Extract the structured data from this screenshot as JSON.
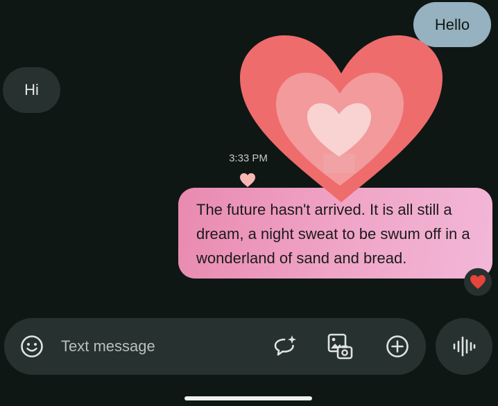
{
  "conversation": {
    "messages": [
      {
        "direction": "outgoing",
        "text": "Hello"
      },
      {
        "direction": "incoming",
        "text": "Hi"
      },
      {
        "direction": "outgoing",
        "text": "The future hasn't arrived. It is all still a dream, a night sweat to be swum off in a wonderland of sand and bread."
      }
    ],
    "timestamp": "3:33 PM",
    "reaction_icon": "heart-icon"
  },
  "compose": {
    "placeholder": "Text message",
    "emoji_icon": "emoji-icon",
    "magic_compose_icon": "magic-compose-icon",
    "gallery_icon": "gallery-icon",
    "attach_icon": "add-icon",
    "voice_icon": "voice-waveform-icon"
  },
  "effects": {
    "heart_colors": [
      "#ef6c6c",
      "#f29a9c",
      "#f8d3d2"
    ]
  }
}
